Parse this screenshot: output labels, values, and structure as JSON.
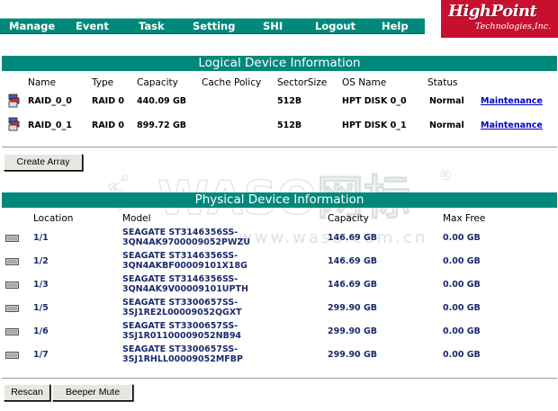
{
  "menu": {
    "items": [
      "Manage",
      "Event",
      "Task",
      "Setting",
      "SHI",
      "Logout",
      "Help"
    ]
  },
  "logo": {
    "brand": "HighPoint",
    "sub": "Technologies,Inc."
  },
  "logical": {
    "title": "Logical Device Information",
    "headers": {
      "name": "Name",
      "type": "Type",
      "capacity": "Capacity",
      "cache_policy": "Cache Policy",
      "sector_size": "SectorSize",
      "os_name": "OS Name",
      "status": "Status"
    },
    "rows": [
      {
        "name": "RAID_0_0",
        "type": "RAID 0",
        "capacity": "440.09 GB",
        "cache_policy": "",
        "sector_size": "512B",
        "os_name": "HPT DISK 0_0",
        "status": "Normal",
        "action": "Maintenance"
      },
      {
        "name": "RAID_0_1",
        "type": "RAID 0",
        "capacity": "899.72 GB",
        "cache_policy": "",
        "sector_size": "512B",
        "os_name": "HPT DISK 0_1",
        "status": "Normal",
        "action": "Maintenance"
      }
    ],
    "create_button": "Create Array"
  },
  "physical": {
    "title": "Physical Device Information",
    "headers": {
      "location": "Location",
      "model": "Model",
      "capacity": "Capacity",
      "max_free": "Max Free"
    },
    "rows": [
      {
        "location": "1/1",
        "model_l1": "SEAGATE ST3146356SS-",
        "model_l2": "3QN4AK9700009052PWZU",
        "capacity": "146.69 GB",
        "max_free": "0.00 GB"
      },
      {
        "location": "1/2",
        "model_l1": "SEAGATE ST3146356SS-",
        "model_l2": "3QN4AKBF00009101X18G",
        "capacity": "146.69 GB",
        "max_free": "0.00 GB"
      },
      {
        "location": "1/3",
        "model_l1": "SEAGATE ST3146356SS-",
        "model_l2": "3QN4AK9V00009101UPTH",
        "capacity": "146.69 GB",
        "max_free": "0.00 GB"
      },
      {
        "location": "1/5",
        "model_l1": "SEAGATE ST3300657SS-",
        "model_l2": "3SJ1RE2L00009052QGXT",
        "capacity": "299.90 GB",
        "max_free": "0.00 GB"
      },
      {
        "location": "1/6",
        "model_l1": "SEAGATE ST3300657SS-",
        "model_l2": "3SJ1R01100009052NB94",
        "capacity": "299.90 GB",
        "max_free": "0.00 GB"
      },
      {
        "location": "1/7",
        "model_l1": "SEAGATE ST3300657SS-",
        "model_l2": "3SJ1RHLL00009052MFBP",
        "capacity": "299.90 GB",
        "max_free": "0.00 GB"
      }
    ],
    "rescan_button": "Rescan",
    "beeper_button": "Beeper Mute"
  },
  "watermark": {
    "text": "WASO网标",
    "url": "www.waso.com.cn",
    "mark": "®"
  },
  "colors": {
    "teal": "#00897b",
    "brand_red": "#c8102e",
    "navy_text": "#1a2a6c",
    "link": "#0000cc"
  }
}
